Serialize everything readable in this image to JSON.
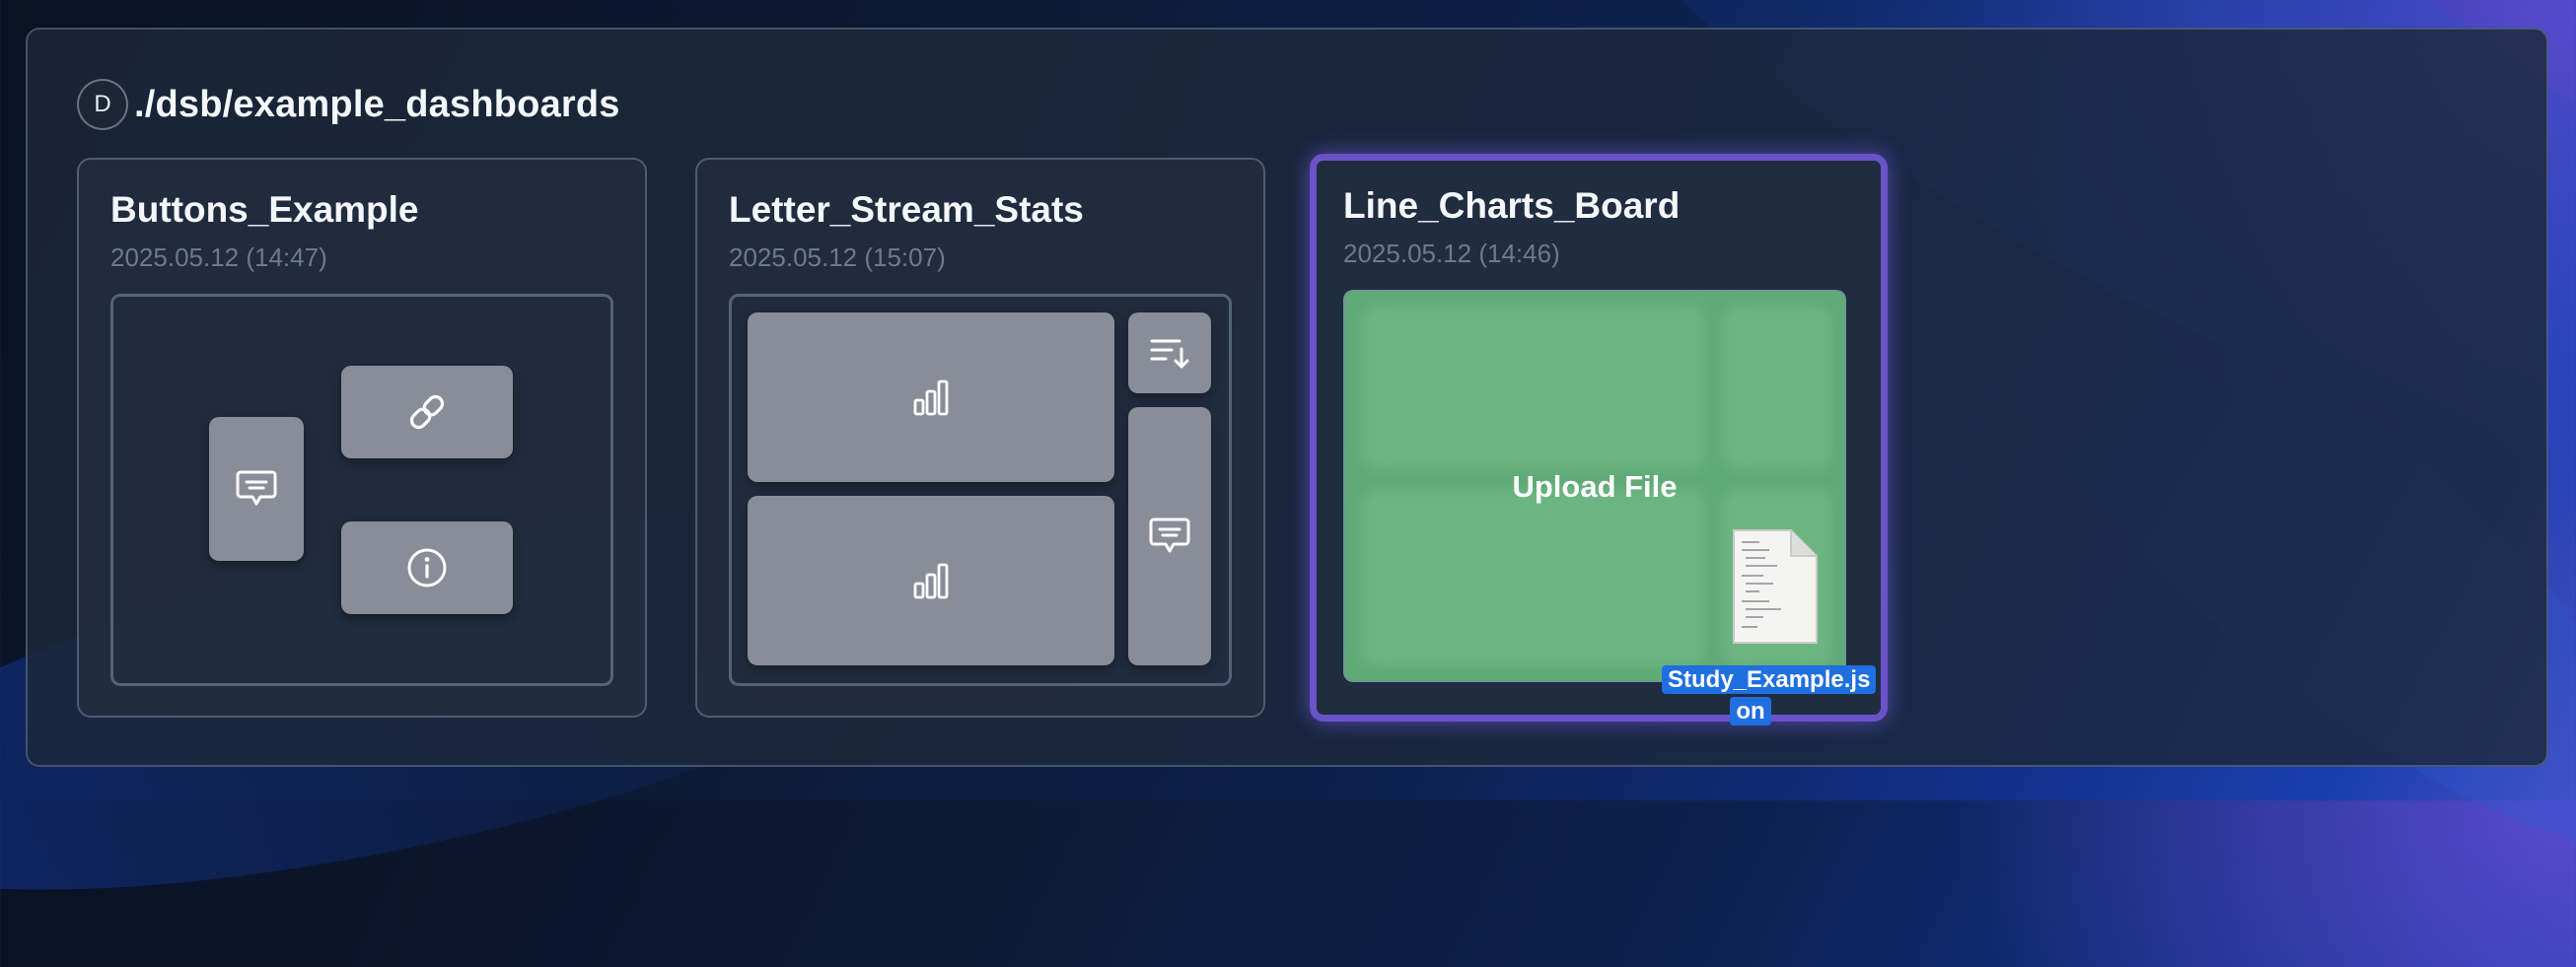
{
  "header": {
    "avatar_letter": "D",
    "path": "./dsb/example_dashboards"
  },
  "dashboards": [
    {
      "title": "Buttons_Example",
      "date": "2025.05.12 (14:47)",
      "widgets": [
        "comment-icon",
        "link-icon",
        "info-icon"
      ]
    },
    {
      "title": "Letter_Stream_Stats",
      "date": "2025.05.12 (15:07)",
      "widgets": [
        "bar-chart-icon",
        "bar-chart-icon",
        "sort-list-icon",
        "comment-icon"
      ]
    },
    {
      "title": "Line_Charts_Board",
      "date": "2025.05.12 (14:46)",
      "drop_label": "Upload File",
      "dragged_file": {
        "name_line1": "Study_Example.js",
        "name_line2": "on"
      }
    }
  ],
  "colors": {
    "accent_border": "#6a52c8",
    "drop_green": "#5faa76",
    "tile_gray": "#888d97",
    "file_label_bg": "#1f6fe0"
  }
}
